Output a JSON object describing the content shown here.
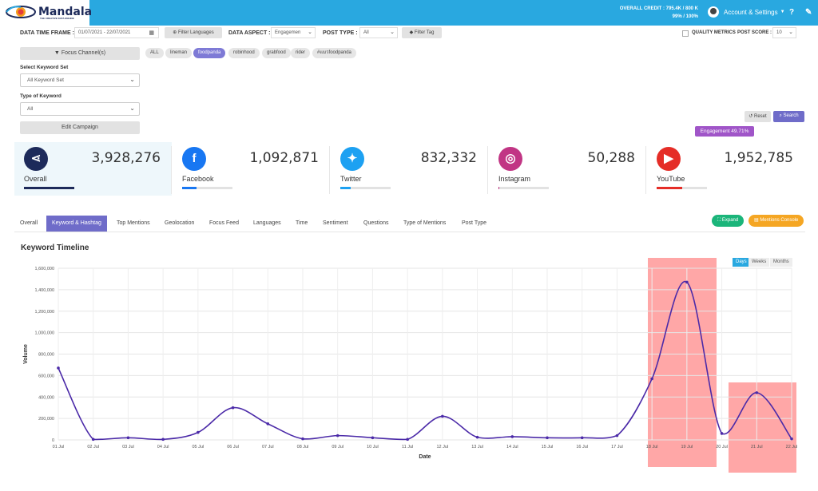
{
  "header": {
    "brand": "Mandala",
    "tagline": "THE CREATIVE DATA ENGINE",
    "credit_line1": "OVERALL CREDIT : 795.4K / 800 K",
    "credit_line2": "99% / 100%",
    "account_label": "Account & Settings",
    "help_icon": "question-icon",
    "edit_icon": "pencil-icon"
  },
  "filters": {
    "date_label": "DATA TIME FRAME :",
    "date_value": "01/07/2021 - 22/07/2021",
    "filter_languages": "Filter Languages",
    "aspect_label": "DATA ASPECT :",
    "aspect_value": "Engagemen",
    "post_type_label": "POST TYPE :",
    "post_type_value": "All",
    "filter_tag": "Filter Tag",
    "quality_metrics": "QUALITY METRICS",
    "post_score_label": "POST SCORE :",
    "post_score_value": "10",
    "focus_channels": "Focus Channel(s)",
    "keyword_set_label": "Select Keyword Set",
    "keyword_set_value": "All Keyword Set",
    "keyword_type_label": "Type of Keyword",
    "keyword_type_value": "All",
    "edit_campaign": "Edit Campaign",
    "reset": "Reset",
    "search": "Search",
    "chips": [
      "ALL",
      "lineman",
      "foodpanda",
      "robinhood",
      "grabfood",
      "rider",
      "#แมวfoodpanda"
    ],
    "active_chip": "foodpanda",
    "engagement_badge": "Engagement 49.71%"
  },
  "stats": [
    {
      "name": "Overall",
      "value": "3,928,276",
      "icon": "share-icon",
      "color": "#1d2a5a",
      "fill": 1.0
    },
    {
      "name": "Facebook",
      "value": "1,092,871",
      "icon": "facebook-icon",
      "color": "#1877f2",
      "fill": 0.28
    },
    {
      "name": "Twitter",
      "value": "832,332",
      "icon": "twitter-icon",
      "color": "#1da1f2",
      "fill": 0.21
    },
    {
      "name": "Instagram",
      "value": "50,288",
      "icon": "instagram-icon",
      "color": "#c13584",
      "fill": 0.02
    },
    {
      "name": "YouTube",
      "value": "1,952,785",
      "icon": "youtube-icon",
      "color": "#e52d27",
      "fill": 0.5
    }
  ],
  "tabs": [
    "Overall",
    "Keyword & Hashtag",
    "Top Mentions",
    "Geolocation",
    "Focus Feed",
    "Languages",
    "Time",
    "Sentiment",
    "Questions",
    "Type of Mentions",
    "Post Type"
  ],
  "active_tab": "Keyword & Hashtag",
  "expand_label": "Expand",
  "mentions_console_label": "Mentions Console",
  "chart_title": "Keyword Timeline",
  "granularity": [
    "Days",
    "Weeks",
    "Months"
  ],
  "active_granularity": "Days",
  "chart_data": {
    "type": "line",
    "title": "Keyword Timeline",
    "xlabel": "Date",
    "ylabel": "Volume",
    "ylim": [
      0,
      1600000
    ],
    "yticks": [
      0,
      200000,
      400000,
      600000,
      800000,
      1000000,
      1200000,
      1400000,
      1600000
    ],
    "ytick_labels": [
      "0",
      "200,000",
      "400,000",
      "600,000",
      "800,000",
      "1,000,000",
      "1,200,000",
      "1,400,000",
      "1,600,000"
    ],
    "x": [
      "01 Jul",
      "02 Jul",
      "03 Jul",
      "04 Jul",
      "05 Jul",
      "06 Jul",
      "07 Jul",
      "08 Jul",
      "09 Jul",
      "10 Jul",
      "11 Jul",
      "12 Jul",
      "13 Jul",
      "14 Jul",
      "15 Jul",
      "16 Jul",
      "17 Jul",
      "18 Jul",
      "19 Jul",
      "20 Jul",
      "21 Jul",
      "22 Jul"
    ],
    "values": [
      670000,
      5000,
      20000,
      5000,
      70000,
      300000,
      150000,
      10000,
      40000,
      20000,
      5000,
      220000,
      25000,
      30000,
      20000,
      20000,
      40000,
      570000,
      1470000,
      60000,
      440000,
      10000
    ],
    "line_color": "#4b2aa8",
    "grid": true,
    "highlights": [
      {
        "from": "18 Jul",
        "to": "20 Jul",
        "color": "#ff8a8a"
      },
      {
        "from": "21 Jul",
        "to": "22 Jul",
        "color": "#ff8a8a"
      }
    ]
  }
}
